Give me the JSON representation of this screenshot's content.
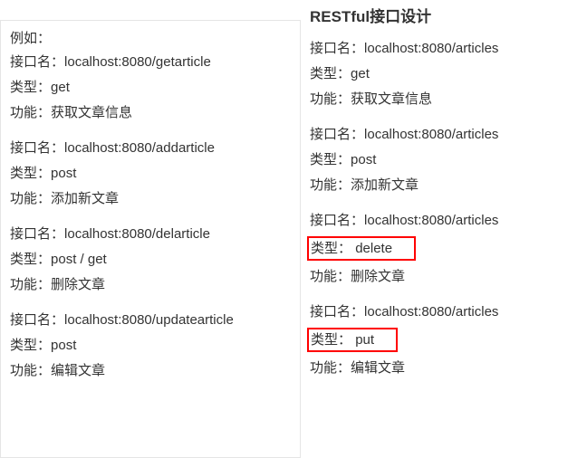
{
  "left": {
    "lead": "例如：",
    "groups": [
      {
        "name_lbl": "接口名：",
        "name_val": "localhost:8080/getarticle",
        "type_lbl": "类型：",
        "type_val": "get",
        "func_lbl": "功能：",
        "func_val": "获取文章信息"
      },
      {
        "name_lbl": "接口名：",
        "name_val": "localhost:8080/addarticle",
        "type_lbl": "类型：",
        "type_val": "post",
        "func_lbl": "功能：",
        "func_val": "添加新文章"
      },
      {
        "name_lbl": "接口名：",
        "name_val": "localhost:8080/delarticle",
        "type_lbl": "类型：",
        "type_val": "post / get",
        "func_lbl": "功能：",
        "func_val": "删除文章"
      },
      {
        "name_lbl": "接口名：",
        "name_val": "localhost:8080/updatearticle",
        "type_lbl": "类型：",
        "type_val": "post",
        "func_lbl": "功能：",
        "func_val": "编辑文章"
      }
    ]
  },
  "right": {
    "title": "RESTful接口设计",
    "groups": [
      {
        "name_lbl": "接口名：",
        "name_val": "localhost:8080/articles",
        "type_lbl": "类型：",
        "type_val": "get",
        "hl": false,
        "func_lbl": "功能：",
        "func_val": "获取文章信息"
      },
      {
        "name_lbl": "接口名：",
        "name_val": "localhost:8080/articles",
        "type_lbl": "类型：",
        "type_val": "post",
        "hl": false,
        "func_lbl": "功能：",
        "func_val": "添加新文章"
      },
      {
        "name_lbl": "接口名：",
        "name_val": "localhost:8080/articles",
        "type_lbl": "类型：",
        "type_val": "delete",
        "hl": true,
        "func_lbl": "功能：",
        "func_val": "删除文章"
      },
      {
        "name_lbl": "接口名：",
        "name_val": "localhost:8080/articles",
        "type_lbl": "类型：",
        "type_val": "put",
        "hl": true,
        "func_lbl": "功能：",
        "func_val": "编辑文章"
      }
    ]
  }
}
